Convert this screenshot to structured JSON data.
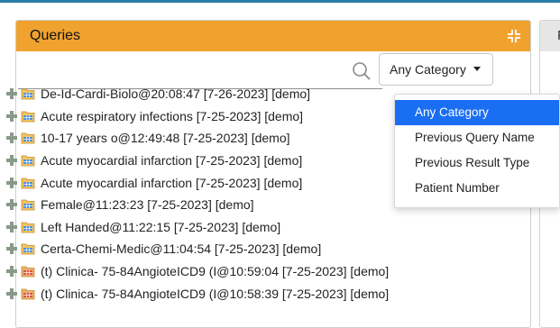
{
  "panel": {
    "title": "Queries"
  },
  "side_panel": {
    "title_fragment": "F"
  },
  "search": {
    "value": "",
    "placeholder": ""
  },
  "category": {
    "selected": "Any Category",
    "options": [
      {
        "label": "Any Category",
        "active": true
      },
      {
        "label": "Previous Query Name",
        "active": false
      },
      {
        "label": "Previous Result Type",
        "active": false
      },
      {
        "label": "Patient Number",
        "active": false
      }
    ]
  },
  "queries": [
    {
      "label": "De-Id-Cardi-Biolo@20:08:47 [7-26-2023] [demo]",
      "icon": "query-folder-icon"
    },
    {
      "label": "Acute respiratory infections [7-25-2023] [demo]",
      "icon": "query-folder-icon"
    },
    {
      "label": " 10-17 years o@12:49:48 [7-25-2023] [demo]",
      "icon": "query-folder-icon"
    },
    {
      "label": "Acute myocardial infarction [7-25-2023] [demo]",
      "icon": "query-folder-icon"
    },
    {
      "label": "Acute myocardial infarction [7-25-2023] [demo]",
      "icon": "query-folder-icon"
    },
    {
      "label": "Female@11:23:23 [7-25-2023] [demo]",
      "icon": "query-folder-icon"
    },
    {
      "label": "Left Handed@11:22:15 [7-25-2023] [demo]",
      "icon": "query-folder-icon"
    },
    {
      "label": "Certa-Chemi-Medic@11:04:54 [7-25-2023] [demo]",
      "icon": "query-folder-icon"
    },
    {
      "label": "(t) Clinica- 75-84AngioteICD9 (I@10:59:04 [7-25-2023] [demo]",
      "icon": "temporal-query-folder-icon"
    },
    {
      "label": "(t) Clinica- 75-84AngioteICD9 (I@10:58:39 [7-25-2023] [demo]",
      "icon": "temporal-query-folder-icon"
    }
  ],
  "colors": {
    "header": "#f0a22e",
    "accent_blue": "#1a6ef2",
    "plus_green": "#8a9a8a",
    "top_line": "#2a7fa8"
  }
}
